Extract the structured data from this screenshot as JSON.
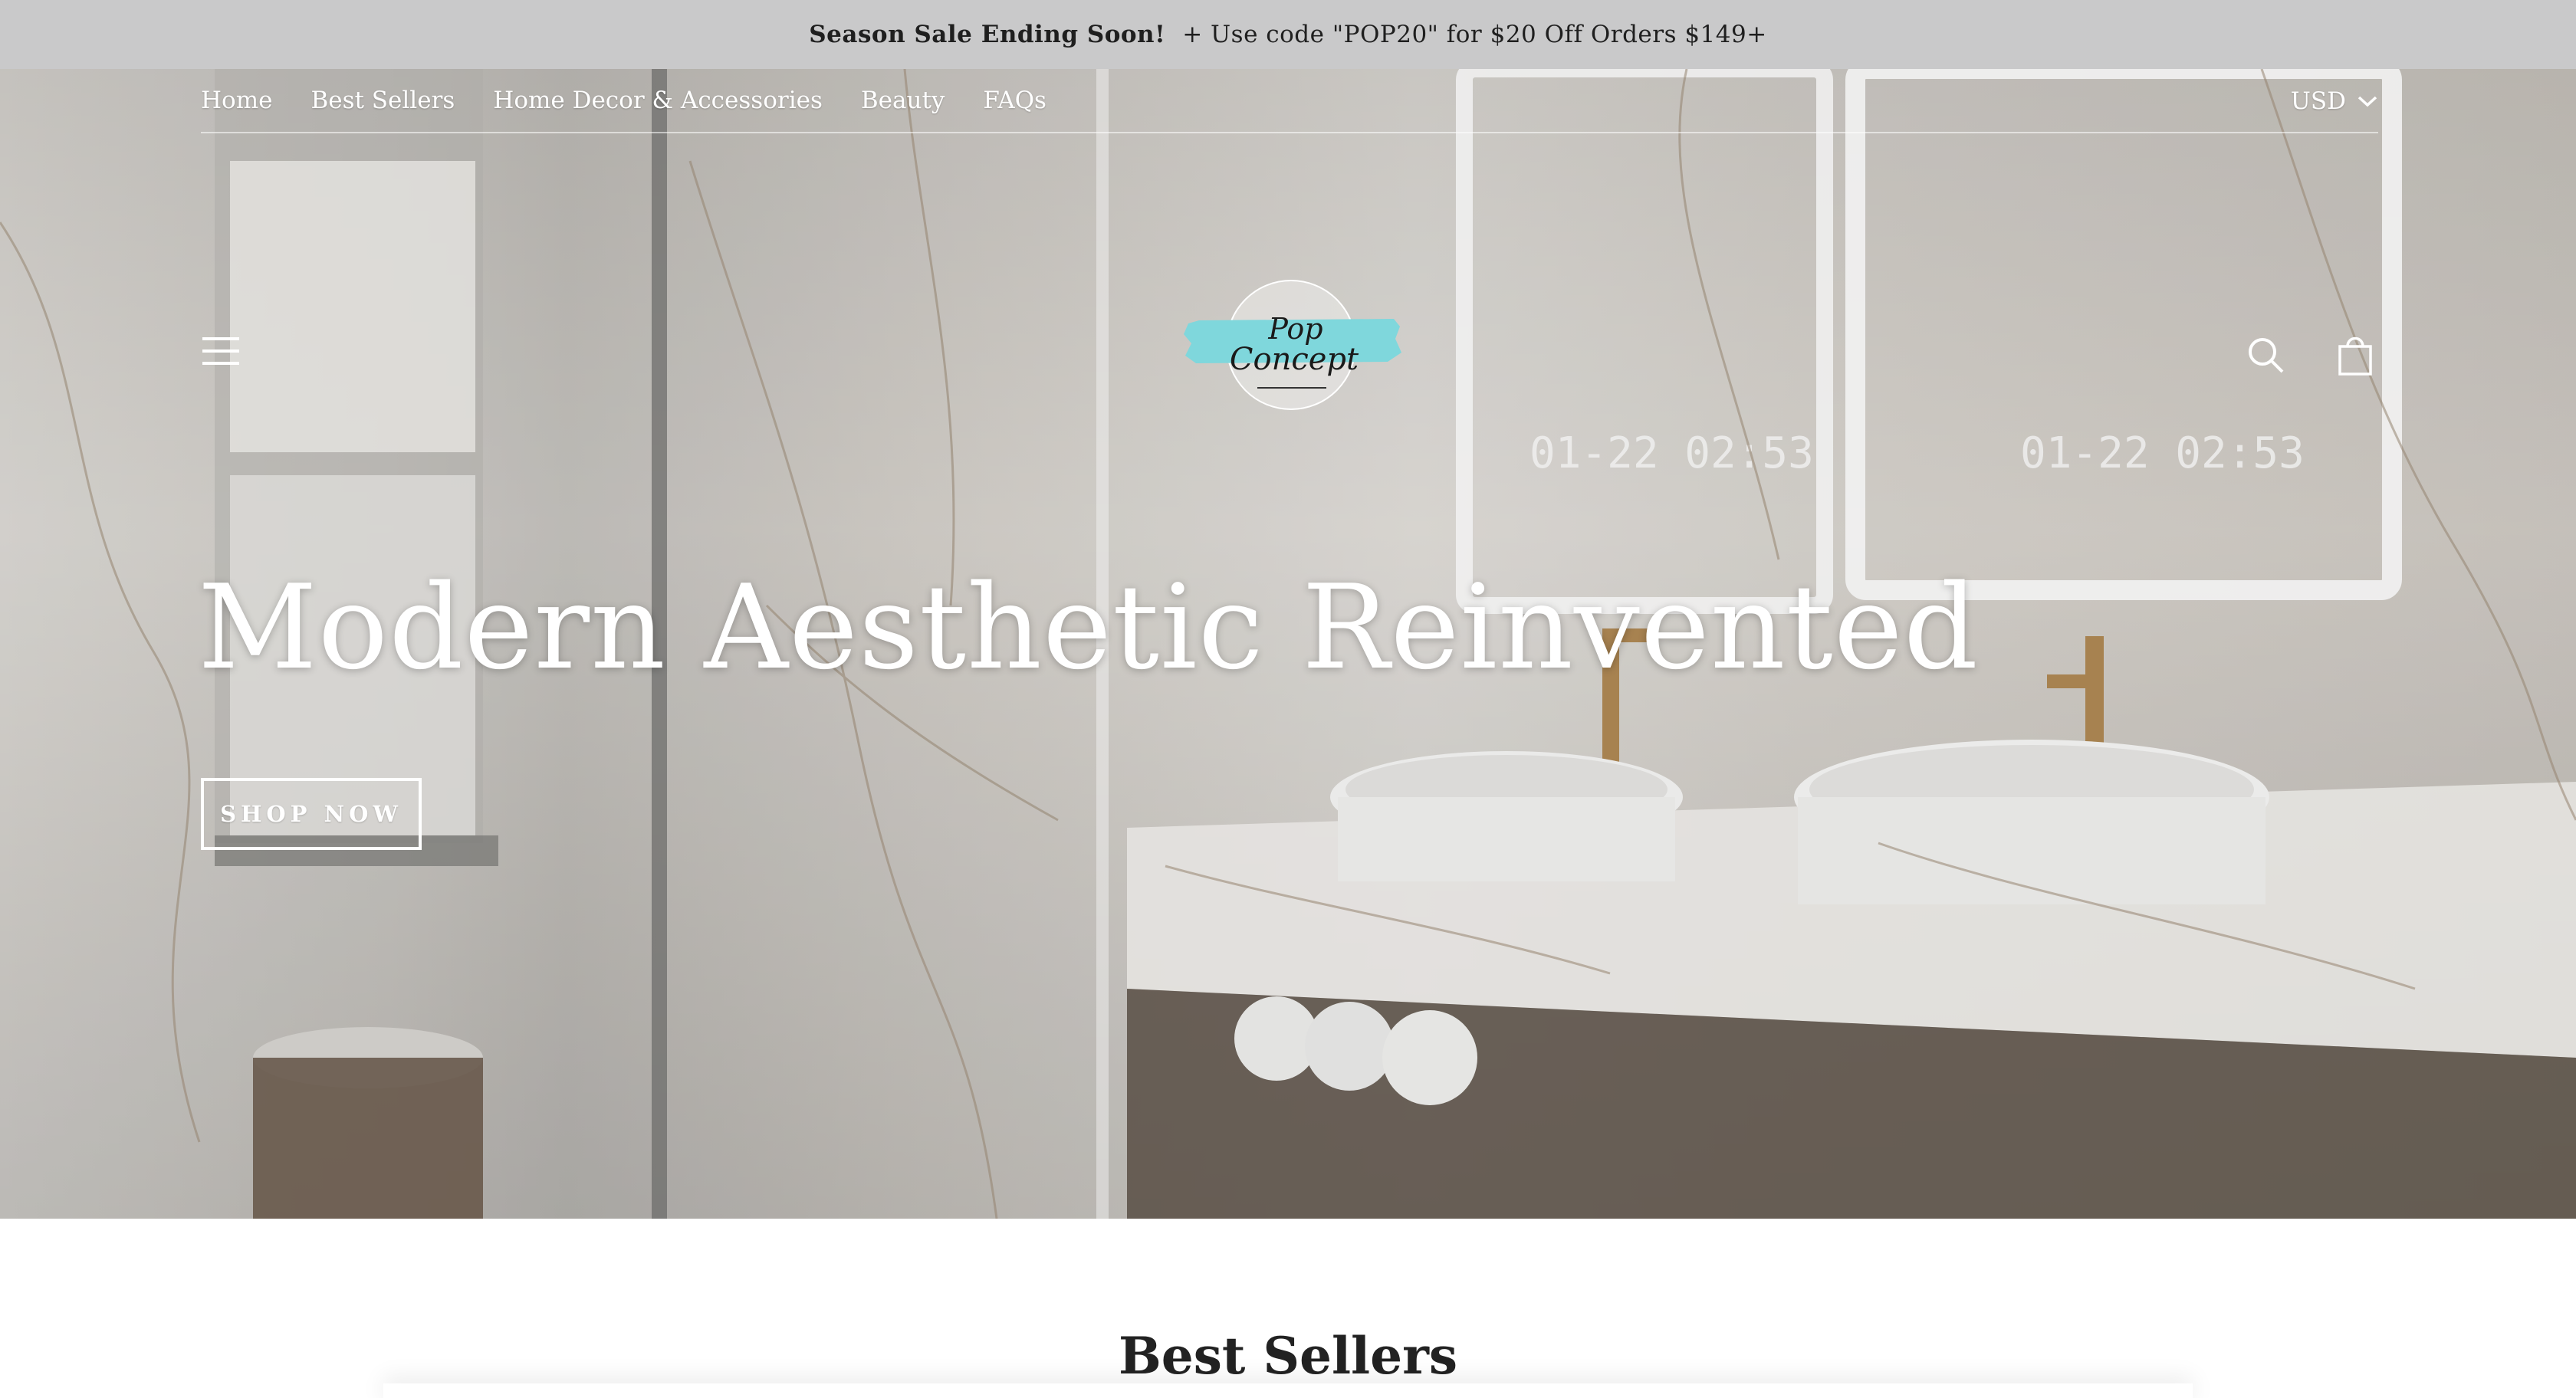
{
  "announcement": {
    "strong": "Season Sale Ending Soon!",
    "text": "+ Use code \"POP20\" for $20 Off Orders $149+"
  },
  "nav": {
    "links": [
      "Home",
      "Best Sellers",
      "Home Decor & Accessories",
      "Beauty",
      "FAQs"
    ],
    "currency": "USD"
  },
  "header": {
    "icons": [
      "hamburger-menu-icon",
      "search-icon",
      "cart-icon"
    ],
    "logo": {
      "line1": "Pop",
      "line2": "Concept",
      "accent_color": "#7fd7dc"
    }
  },
  "hero": {
    "title": "Modern Aesthetic Reinvented",
    "cta": "SHOP NOW"
  },
  "sections": {
    "best_sellers_title": "Best Sellers"
  }
}
